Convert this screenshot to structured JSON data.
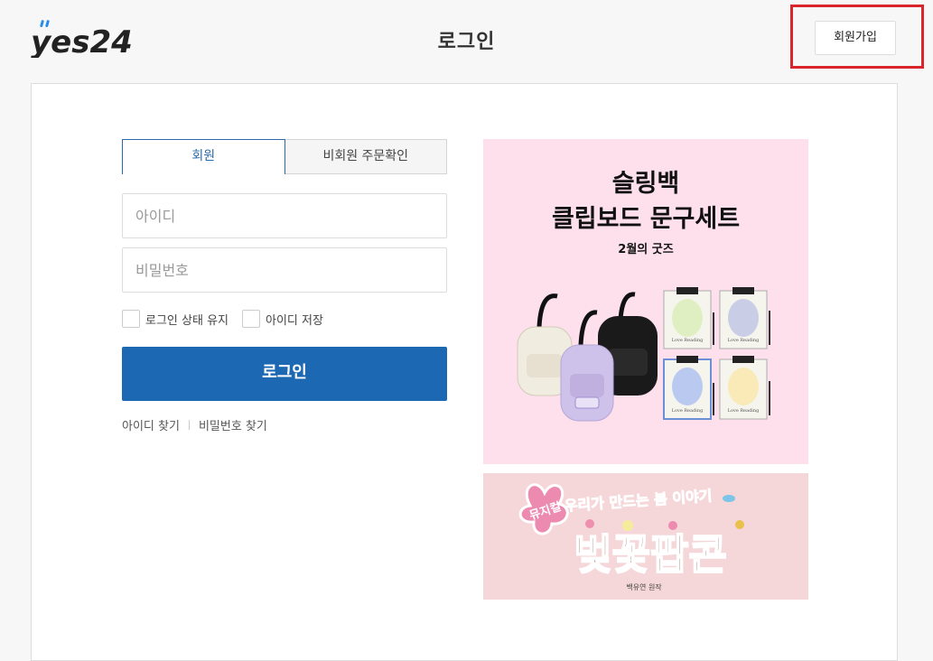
{
  "header": {
    "logo_text": "yes24",
    "title": "로그인",
    "join_label": "회원가입"
  },
  "tabs": [
    {
      "label": "회원",
      "active": true
    },
    {
      "label": "비회원 주문확인",
      "active": false
    }
  ],
  "form": {
    "id_placeholder": "아이디",
    "pw_placeholder": "비밀번호",
    "keep_login_label": "로그인 상태 유지",
    "save_id_label": "아이디 저장",
    "login_label": "로그인",
    "find_id_label": "아이디 찾기",
    "find_pw_label": "비밀번호 찾기"
  },
  "banner1": {
    "title_line1": "슬링백",
    "title_line2": "클립보드 문구세트",
    "subtitle": "2월의 굿즈",
    "clip_text": "Love Reading"
  },
  "banner2": {
    "tagline": "우리가 만드는 봄 이야기",
    "badge": "뮤지컬",
    "title": "벚꽃팝콘",
    "credit": "백유연 원작"
  },
  "colors": {
    "primary": "#1c68b3",
    "highlight": "#d9262c",
    "banner1_bg": "#fde0ec",
    "banner2_bg": "#f6d7d9"
  }
}
